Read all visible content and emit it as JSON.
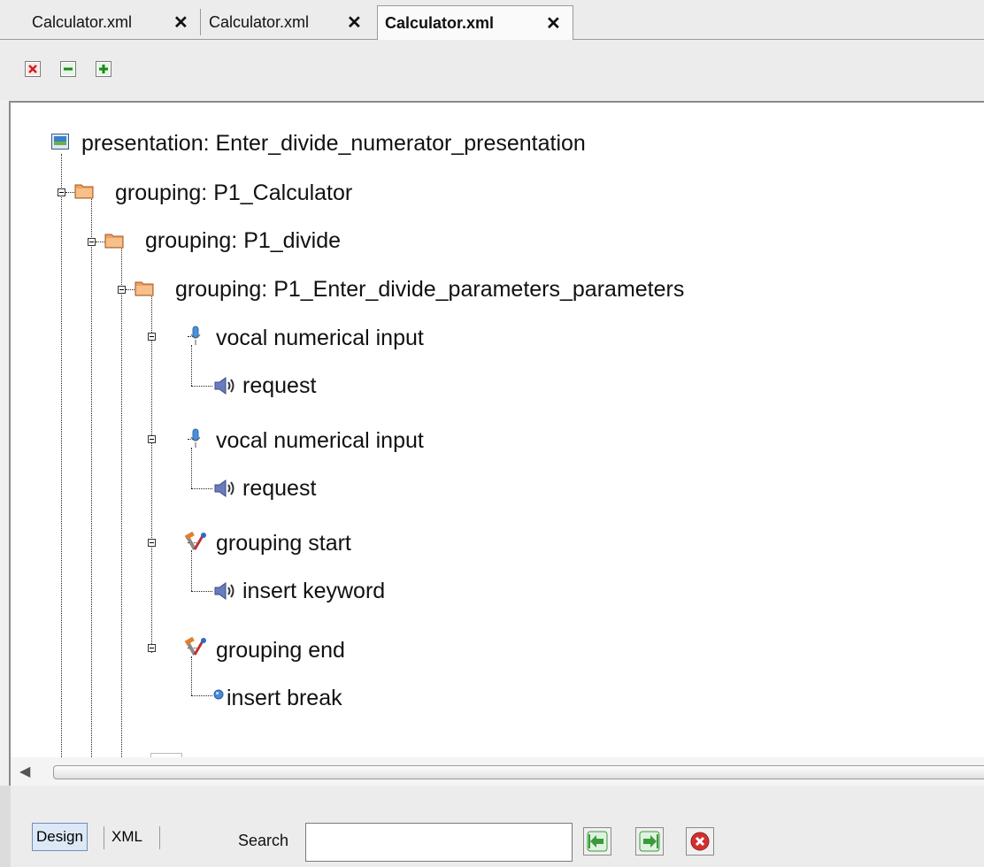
{
  "tabs": [
    {
      "label": "Calculator.xml",
      "close": "✕",
      "active": false
    },
    {
      "label": "Calculator.xml",
      "close": "✕",
      "active": false
    },
    {
      "label": "Calculator.xml",
      "close": "✕",
      "active": true
    }
  ],
  "toolbar": {
    "buttons": [
      "remove-node",
      "collapse-all",
      "expand-all"
    ]
  },
  "tree": {
    "nodes": [
      {
        "label": "presentation: Enter_divide_numerator_presentation",
        "icon": "presentation-icon"
      },
      {
        "label": "grouping: P1_Calculator",
        "icon": "folder-icon"
      },
      {
        "label": "grouping: P1_divide",
        "icon": "folder-icon"
      },
      {
        "label": "grouping: P1_Enter_divide_parameters_parameters",
        "icon": "folder-icon"
      },
      {
        "label": "vocal numerical input",
        "icon": "microphone-icon"
      },
      {
        "label": "request",
        "icon": "speaker-icon"
      },
      {
        "label": "vocal numerical input",
        "icon": "microphone-icon"
      },
      {
        "label": "request",
        "icon": "speaker-icon"
      },
      {
        "label": "grouping start",
        "icon": "hammer-wrench-icon"
      },
      {
        "label": "insert keyword",
        "icon": "speaker-icon"
      },
      {
        "label": "grouping end",
        "icon": "hammer-wrench-icon"
      },
      {
        "label": "insert break",
        "icon": "blue-dot-icon"
      }
    ]
  },
  "bottom": {
    "views": [
      "Design",
      "XML"
    ],
    "active_view": "Design",
    "search_label": "Search",
    "search_value": "",
    "buttons": [
      "previous-icon",
      "next-icon",
      "clear-search-icon"
    ]
  },
  "colors": {
    "folder": "#f0a060",
    "speaker": "#6a7cc0",
    "microphone": "#4a90d9",
    "nav_green": "#3a9a3a",
    "clear_red": "#d03030"
  }
}
